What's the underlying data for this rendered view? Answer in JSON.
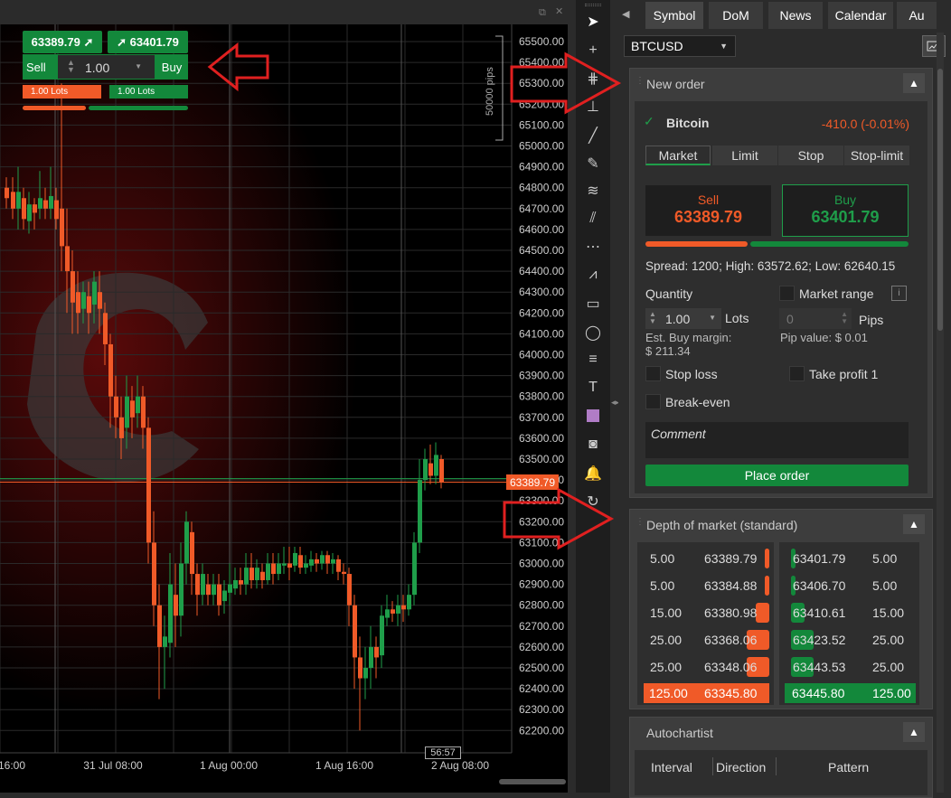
{
  "colors": {
    "sell": "#f05a28",
    "buy": "#13883b",
    "up_candle": "#1f9e4a",
    "down_candle": "#f05a28",
    "arrow": "#e02020"
  },
  "chart": {
    "price_axis": [
      "65500.00",
      "65400.00",
      "65300.00",
      "65200.00",
      "65100.00",
      "65000.00",
      "64900.00",
      "64800.00",
      "64700.00",
      "64600.00",
      "64500.00",
      "64400.00",
      "64300.00",
      "64200.00",
      "64100.00",
      "64000.00",
      "63900.00",
      "63800.00",
      "63700.00",
      "63600.00",
      "63500.00",
      "63400.00",
      "63300.00",
      "63200.00",
      "63100.00",
      "63000.00",
      "62900.00",
      "62800.00",
      "62700.00",
      "62600.00",
      "62500.00",
      "62400.00",
      "62300.00",
      "62200.00"
    ],
    "time_axis": [
      "16:00",
      "31 Jul 08:00",
      "1 Aug 00:00",
      "1 Aug 16:00",
      "2 Aug 08:00"
    ],
    "pips_label": "50000 pips",
    "current_price_label": "63389.79",
    "countdown": "56:57",
    "sell_price": "63389.79",
    "buy_price": "63401.79",
    "sell_label": "Sell",
    "buy_label": "Buy",
    "qty": "1.00",
    "sell_lots": "1.00 Lots",
    "buy_lots": "1.00 Lots"
  },
  "toolbar_icons": [
    "cursor-icon",
    "crosshair-icon",
    "zoom-icon",
    "measure-icon",
    "trendline-icon",
    "brush-icon",
    "fibonacci-icon",
    "pitchfork-icon",
    "fib-levels-icon",
    "gann-fan-icon",
    "rectangle-icon",
    "circle-icon",
    "annotations-icon",
    "text-icon",
    "color-swatch-icon",
    "camera-icon",
    "alert-bell-icon",
    "replay-icon"
  ],
  "tabs": [
    "Symbol",
    "DoM",
    "News",
    "Calendar",
    "Au"
  ],
  "symbol": "BTCUSD",
  "new_order": {
    "title": "New order",
    "instrument": "Bitcoin",
    "change": "-410.0 (-0.01%)",
    "order_types": [
      "Market",
      "Limit",
      "Stop",
      "Stop-limit"
    ],
    "sell_label": "Sell",
    "sell_price": "63389.79",
    "buy_label": "Buy",
    "buy_price": "63401.79",
    "spread_line": "Spread: 1200; High: 63572.62; Low: 62640.15",
    "quantity_label": "Quantity",
    "quantity_value": "1.00",
    "lots_label": "Lots",
    "market_range_label": "Market range",
    "pips_value": "0",
    "pips_label": "Pips",
    "est_margin": "Est. Buy margin:",
    "est_margin_value": "$ 211.34",
    "pip_value": "Pip value: $ 0.01",
    "stop_loss": "Stop loss",
    "take_profit": "Take profit 1",
    "break_even": "Break-even",
    "comment_placeholder": "Comment",
    "place_order": "Place order"
  },
  "dom": {
    "title": "Depth of market (standard)",
    "bids": [
      [
        "5.00",
        "63389.79"
      ],
      [
        "5.00",
        "63384.88"
      ],
      [
        "15.00",
        "63380.98"
      ],
      [
        "25.00",
        "63368.06"
      ],
      [
        "25.00",
        "63348.06"
      ]
    ],
    "asks": [
      [
        "63401.79",
        "5.00"
      ],
      [
        "63406.70",
        "5.00"
      ],
      [
        "63410.61",
        "15.00"
      ],
      [
        "63423.52",
        "25.00"
      ],
      [
        "63443.53",
        "25.00"
      ]
    ],
    "bid_total": [
      "125.00",
      "63345.80"
    ],
    "ask_total": [
      "63445.80",
      "125.00"
    ]
  },
  "autochartist": {
    "title": "Autochartist",
    "columns": [
      "Interval",
      "Direction",
      "Pattern"
    ]
  }
}
